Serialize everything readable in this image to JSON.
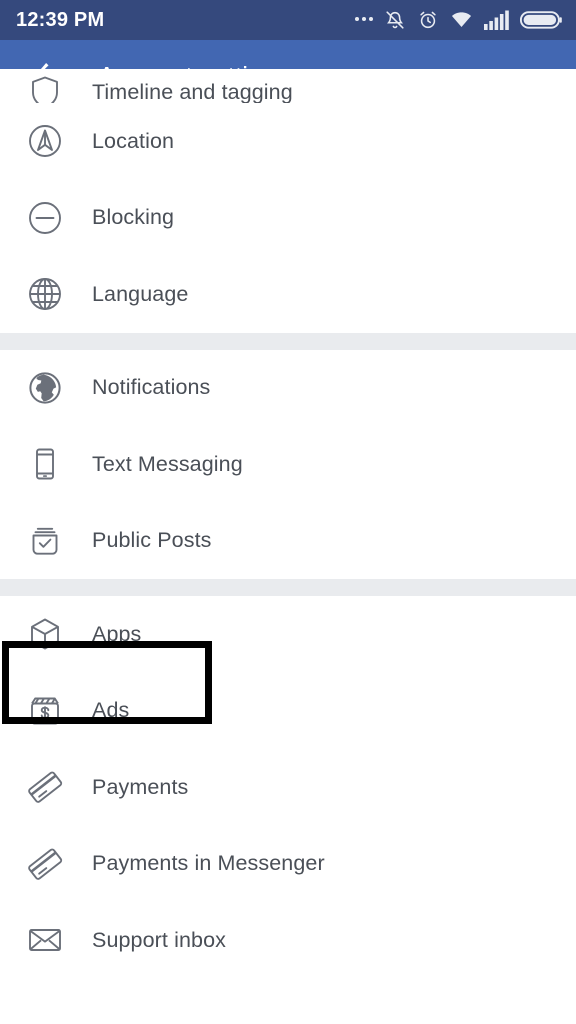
{
  "status_bar": {
    "time": "12:39 PM",
    "icons": [
      {
        "name": "more-dots-icon",
        "label": "..."
      },
      {
        "name": "notifications-muted-icon",
        "label": "Silent / vibrate"
      },
      {
        "name": "alarm-clock-icon",
        "label": "Alarm set"
      },
      {
        "name": "wifi-icon",
        "label": "Wi-Fi connected"
      },
      {
        "name": "cellular-signal-icon",
        "label": "Signal full"
      },
      {
        "name": "battery-icon",
        "label": "Battery full"
      }
    ],
    "background_color": "#35497d",
    "foreground_color": "#ffffff"
  },
  "toolbar": {
    "title": "Account settings",
    "back_label": "Back",
    "background_color": "#4267b2",
    "title_color": "#ffffff"
  },
  "theme": {
    "page_background": "#ffffff",
    "divider_color": "#e9ebee",
    "row_label_color": "#4a4f57",
    "icon_color": "#6b707a",
    "highlight_box_color": "#000000"
  },
  "list": {
    "groups": [
      {
        "id": "group-privacy",
        "items": [
          {
            "id": "timeline-and-tagging",
            "label": "Timeline and tagging",
            "icon": "shield-icon",
            "clipped": true,
            "highlighted": false
          },
          {
            "id": "location",
            "label": "Location",
            "icon": "location-compass-icon",
            "clipped": false,
            "highlighted": false
          },
          {
            "id": "blocking",
            "label": "Blocking",
            "icon": "block-minus-circle-icon",
            "clipped": false,
            "highlighted": false
          },
          {
            "id": "language",
            "label": "Language",
            "icon": "globe-grid-icon",
            "clipped": false,
            "highlighted": false
          }
        ]
      },
      {
        "id": "group-notifications",
        "items": [
          {
            "id": "notifications",
            "label": "Notifications",
            "icon": "earth-globe-icon",
            "clipped": false,
            "highlighted": false
          },
          {
            "id": "text-messaging",
            "label": "Text Messaging",
            "icon": "mobile-phone-icon",
            "clipped": false,
            "highlighted": false
          },
          {
            "id": "public-posts",
            "label": "Public Posts",
            "icon": "inbox-check-icon",
            "clipped": false,
            "highlighted": false
          }
        ]
      },
      {
        "id": "group-apps-payments",
        "items": [
          {
            "id": "apps",
            "label": "Apps",
            "icon": "cube-box-icon",
            "clipped": false,
            "highlighted": true
          },
          {
            "id": "ads",
            "label": "Ads",
            "icon": "ads-dollar-icon",
            "clipped": false,
            "highlighted": false
          },
          {
            "id": "payments",
            "label": "Payments",
            "icon": "credit-card-icon",
            "clipped": false,
            "highlighted": false
          },
          {
            "id": "payments-in-messenger",
            "label": "Payments in Messenger",
            "icon": "credit-card-icon",
            "clipped": false,
            "highlighted": false
          },
          {
            "id": "support-inbox",
            "label": "Support inbox",
            "icon": "envelope-icon",
            "clipped": false,
            "highlighted": false
          }
        ]
      }
    ]
  }
}
